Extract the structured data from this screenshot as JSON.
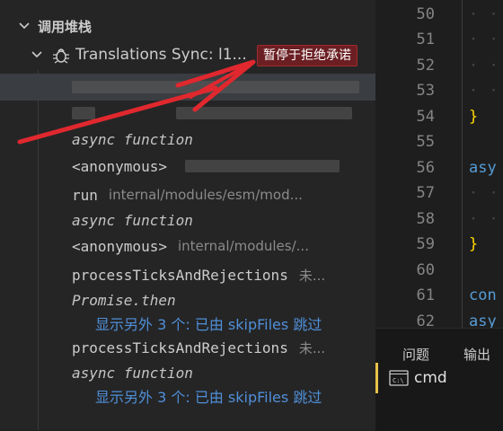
{
  "call_stack": {
    "header": "调用堆栈",
    "thread_name": "Translations Sync: l1...",
    "paused_badge": "暂停于拒绝承诺",
    "frames": [
      {
        "name": "async function"
      },
      {
        "name": "<anonymous>"
      },
      {
        "name": "run",
        "path": "internal/modules/esm/mod..."
      },
      {
        "name": "async function"
      },
      {
        "name": "<anonymous>",
        "path": "internal/modules/..."
      },
      {
        "name": "processTicksAndRejections",
        "path": "未..."
      },
      {
        "name": "Promise.then"
      },
      {
        "name": "显示另外 3 个: 已由 skipFiles 跳过"
      },
      {
        "name": "processTicksAndRejections",
        "path": "未..."
      },
      {
        "name": "async function"
      },
      {
        "name": "显示另外 3 个: 已由 skipFiles 跳过"
      }
    ]
  },
  "editor": {
    "line_numbers": [
      "50",
      "51",
      "52",
      "53",
      "54",
      "55",
      "56",
      "57",
      "58",
      "59",
      "60",
      "61",
      "62"
    ],
    "code_fragments": {
      "54": "}",
      "56": "asy",
      "59": "}",
      "61": "con",
      "62": "asy"
    }
  },
  "panel": {
    "tabs": [
      "问题",
      "输出"
    ],
    "terminal": "cmd",
    "terminal_icon_text": "C:\\"
  },
  "colors": {
    "badge_bg": "#6b1f23",
    "link": "#4f8fd8",
    "brace": "#ffd700",
    "keyword": "#569cd6",
    "annotation_arrow": "#e0282e"
  }
}
